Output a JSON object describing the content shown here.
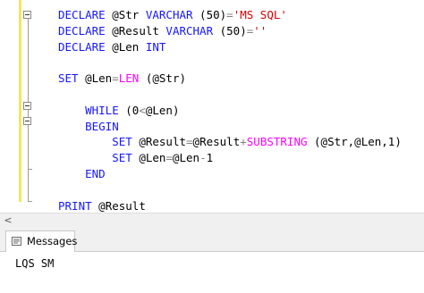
{
  "editor": {
    "lines": [
      [
        {
          "t": "DECLARE",
          "c": "kw"
        },
        {
          "t": " @Str ",
          "c": "pl"
        },
        {
          "t": "VARCHAR",
          "c": "kw"
        },
        {
          "t": " (50)",
          "c": "pl"
        },
        {
          "t": "=",
          "c": "op"
        },
        {
          "t": "'MS SQL'",
          "c": "str"
        }
      ],
      [
        {
          "t": "DECLARE",
          "c": "kw"
        },
        {
          "t": " @Result ",
          "c": "pl"
        },
        {
          "t": "VARCHAR",
          "c": "kw"
        },
        {
          "t": " (50)",
          "c": "pl"
        },
        {
          "t": "=",
          "c": "op"
        },
        {
          "t": "''",
          "c": "str"
        }
      ],
      [
        {
          "t": "DECLARE",
          "c": "kw"
        },
        {
          "t": " @Len ",
          "c": "pl"
        },
        {
          "t": "INT",
          "c": "kw"
        }
      ],
      [],
      [
        {
          "t": "SET",
          "c": "kw"
        },
        {
          "t": " @Len",
          "c": "pl"
        },
        {
          "t": "=",
          "c": "op"
        },
        {
          "t": "LEN",
          "c": "fn"
        },
        {
          "t": " (@Str)",
          "c": "pl"
        }
      ],
      [],
      [
        {
          "t": "    WHILE",
          "c": "kw"
        },
        {
          "t": " (0",
          "c": "pl"
        },
        {
          "t": "<",
          "c": "op"
        },
        {
          "t": "@Len)",
          "c": "pl"
        }
      ],
      [
        {
          "t": "    BEGIN",
          "c": "kw"
        }
      ],
      [
        {
          "t": "        SET",
          "c": "kw"
        },
        {
          "t": " @Result",
          "c": "pl"
        },
        {
          "t": "=",
          "c": "op"
        },
        {
          "t": "@Result",
          "c": "pl"
        },
        {
          "t": "+",
          "c": "op"
        },
        {
          "t": "SUBSTRING",
          "c": "fn"
        },
        {
          "t": " (@Str,@Len,1)",
          "c": "pl"
        }
      ],
      [
        {
          "t": "        SET",
          "c": "kw"
        },
        {
          "t": " @Len",
          "c": "pl"
        },
        {
          "t": "=",
          "c": "op"
        },
        {
          "t": "@Len",
          "c": "pl"
        },
        {
          "t": "-",
          "c": "op"
        },
        {
          "t": "1",
          "c": "pl"
        }
      ],
      [
        {
          "t": "    END",
          "c": "kw"
        }
      ],
      [],
      [
        {
          "t": "PRINT",
          "c": "kw"
        },
        {
          "t": " @Result",
          "c": "pl"
        }
      ]
    ]
  },
  "results": {
    "tab_label": "Messages",
    "tab_icon": "messages-icon",
    "output": "LQS SM"
  },
  "scrollbar": {
    "left_arrow": "<"
  },
  "colors": {
    "keyword": "#1717ff",
    "string": "#d40000",
    "function": "#ff00ff",
    "operator": "#808080",
    "change_bar": "#f3e85a"
  }
}
